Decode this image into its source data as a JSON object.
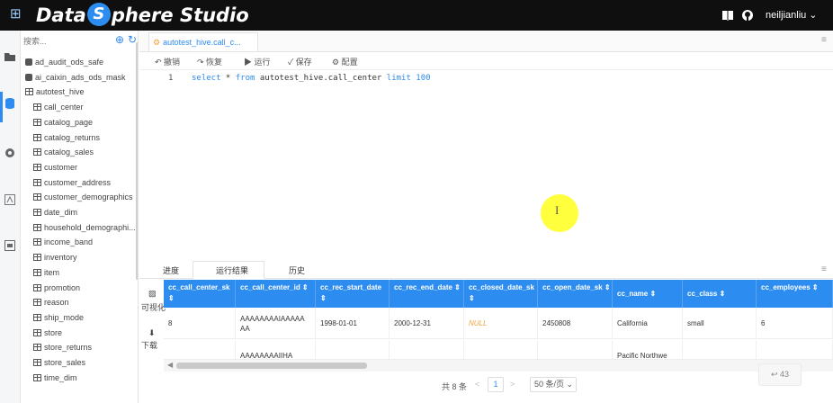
{
  "app": {
    "brand_prefix": "Data",
    "brand_s": "S",
    "brand_suffix": "phere Studio",
    "user": "neiljianliu ⌄"
  },
  "icons": {
    "logo": "grid-icon",
    "book": "book-icon",
    "github": "github-icon"
  },
  "tree": {
    "search_placeholder": "搜索...",
    "items": [
      {
        "label": "ad_audit_ods_safe",
        "type": "db"
      },
      {
        "label": "ai_caixin_ads_ods_mask",
        "type": "db"
      },
      {
        "label": "autotest_hive",
        "type": "db-open"
      },
      {
        "label": "call_center",
        "type": "table"
      },
      {
        "label": "catalog_page",
        "type": "table"
      },
      {
        "label": "catalog_returns",
        "type": "table"
      },
      {
        "label": "catalog_sales",
        "type": "table"
      },
      {
        "label": "customer",
        "type": "table"
      },
      {
        "label": "customer_address",
        "type": "table"
      },
      {
        "label": "customer_demographics",
        "type": "table"
      },
      {
        "label": "date_dim",
        "type": "table"
      },
      {
        "label": "household_demographi...",
        "type": "table"
      },
      {
        "label": "income_band",
        "type": "table"
      },
      {
        "label": "inventory",
        "type": "table"
      },
      {
        "label": "item",
        "type": "table"
      },
      {
        "label": "promotion",
        "type": "table"
      },
      {
        "label": "reason",
        "type": "table"
      },
      {
        "label": "ship_mode",
        "type": "table"
      },
      {
        "label": "store",
        "type": "table"
      },
      {
        "label": "store_returns",
        "type": "table"
      },
      {
        "label": "store_sales",
        "type": "table"
      },
      {
        "label": "time_dim",
        "type": "table"
      }
    ]
  },
  "editor": {
    "tab_label": "autotest_hive.call_c...",
    "toolbar": {
      "undo": "撤销",
      "redo": "恢复",
      "run": "运行",
      "save": "保存",
      "config": "配置"
    },
    "line_number": "1",
    "code": {
      "kw1": "select",
      "star": " * ",
      "kw2": "from",
      "table": " autotest_hive.call_center ",
      "kw3": "limit",
      "num": " 100"
    }
  },
  "results": {
    "tabs": {
      "progress": "进度",
      "result": "运行结果",
      "history": "历史"
    },
    "side": {
      "visualize": "可视化",
      "download": "下载"
    },
    "columns": [
      {
        "label": "cc_call_center_sk ⇕",
        "w": 80
      },
      {
        "label": "cc_call_center_id ⇕",
        "w": 89
      },
      {
        "label": "cc_rec_start_date ⇕",
        "w": 82
      },
      {
        "label": "cc_rec_end_date ⇕",
        "w": 83
      },
      {
        "label": "cc_closed_date_sk ⇕",
        "w": 82
      },
      {
        "label": "cc_open_date_sk ⇕",
        "w": 83
      },
      {
        "label": "cc_name ⇕",
        "w": 78
      },
      {
        "label": "cc_class ⇕",
        "w": 82
      },
      {
        "label": "cc_employees ⇕",
        "w": 85
      }
    ],
    "rows": [
      [
        "8",
        "AAAAAAAAIAAAAAAA",
        "1998-01-01",
        "2000-12-31",
        "NULL",
        "2450808",
        "California",
        "small",
        "6"
      ],
      [
        "",
        "AAAAAAAAIIHA",
        "",
        "",
        "",
        "",
        "Pacific Northwe",
        "",
        ""
      ]
    ],
    "pager": {
      "total": "共 8 条",
      "prev": "<",
      "page": "1",
      "next": ">",
      "page_size": "50 条/页 ⌄"
    },
    "count_badge": "↩ 43"
  }
}
